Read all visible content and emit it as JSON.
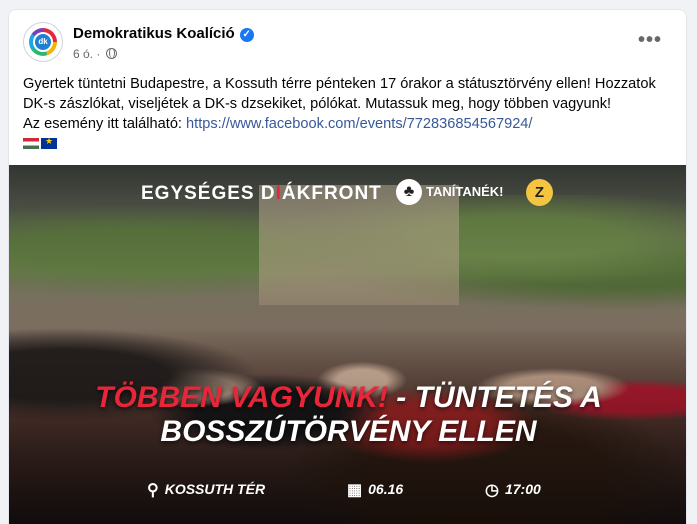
{
  "post": {
    "page_name": "Demokratikus Koalíció",
    "avatar_text": "dk",
    "timestamp": "6 ó.",
    "separator": "·",
    "more_label": "•••",
    "text_line1": "Gyertek tüntetni Budapestre, a Kossuth térre pénteken 17 órakor a státusztörvény ellen! Hozzatok DK-s zászlókat, viseljétek a DK-s dzsekiket, pólókat. Mutassuk meg, hogy többen vagyunk!",
    "text_line2_prefix": "Az esemény itt található: ",
    "event_link": "https://www.facebook.com/events/772836854567924/"
  },
  "image": {
    "brand1_a": "EGYSÉGES D",
    "brand1_b": "ÁKFRONT",
    "brand2": "TANÍTANÉK!",
    "headline_red": "TÖBBEN VAGYUNK!",
    "headline_rest": " - TÜNTETÉS A",
    "headline_line2": "BOSSZÚTÖRVÉNY ELLEN",
    "location": "KOSSUTH TÉR",
    "date": "06.16",
    "time": "17:00"
  },
  "colors": {
    "link": "#385898",
    "verified": "#1877f2",
    "headline_accent": "#e8263a"
  },
  "icons": [
    "verified-badge-icon",
    "globe-icon",
    "more-options-icon",
    "hungarian-flag-icon",
    "eu-flag-icon",
    "map-pin-icon",
    "calendar-icon",
    "clock-icon"
  ]
}
